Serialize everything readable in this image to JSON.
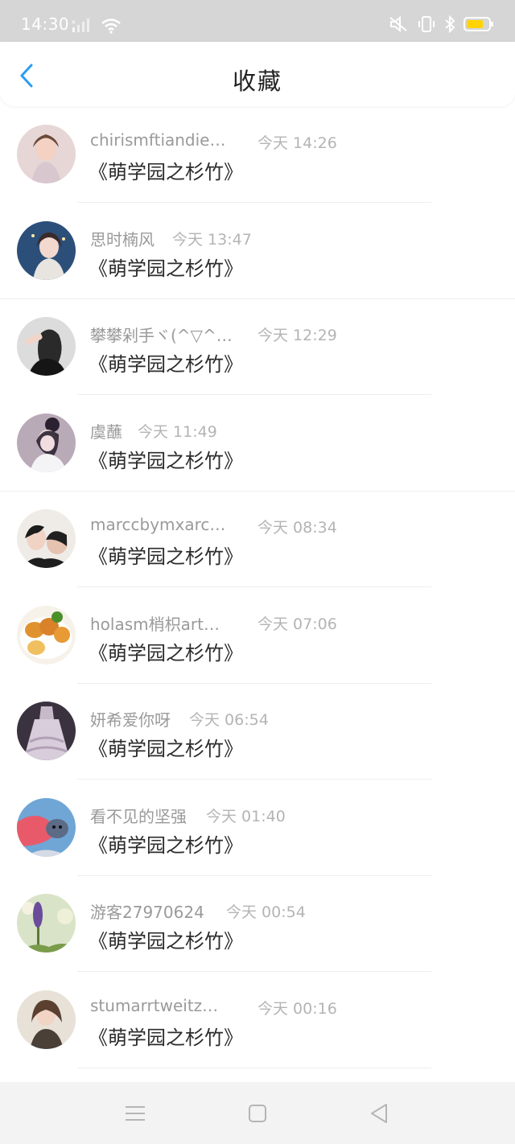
{
  "status_bar": {
    "time": "14:30"
  },
  "header": {
    "title": "收藏"
  },
  "items": [
    {
      "name": "chirismftiandie…",
      "time": "今天 14:26",
      "title": "《萌学园之杉竹》"
    },
    {
      "name": "思时楠风",
      "time": "今天 13:47",
      "title": "《萌学园之杉竹》"
    },
    {
      "name": "攀攀剁手ヾ(^▽^…",
      "time": "今天 12:29",
      "title": "《萌学园之杉竹》"
    },
    {
      "name": "虞蘸",
      "time": "今天 11:49",
      "title": "《萌学园之杉竹》"
    },
    {
      "name": "marccbymxarc…",
      "time": "今天 08:34",
      "title": "《萌学园之杉竹》"
    },
    {
      "name": "holasm梢枳art…",
      "time": "今天 07:06",
      "title": "《萌学园之杉竹》"
    },
    {
      "name": "妍希爱你呀",
      "time": "今天 06:54",
      "title": "《萌学园之杉竹》"
    },
    {
      "name": "看不见的坚强",
      "time": "今天 01:40",
      "title": "《萌学园之杉竹》"
    },
    {
      "name": "游客27970624",
      "time": "今天 00:54",
      "title": "《萌学园之杉竹》"
    },
    {
      "name": "stumarrtweitz…",
      "time": "今天 00:16",
      "title": "《萌学园之杉竹》"
    }
  ],
  "icons": {
    "back": "chevron-left-icon",
    "menu": "menu-icon",
    "home": "square-icon",
    "back_nav": "triangle-back-icon"
  },
  "colors": {
    "accent": "#2a9df4",
    "battery": "#ffd400"
  }
}
